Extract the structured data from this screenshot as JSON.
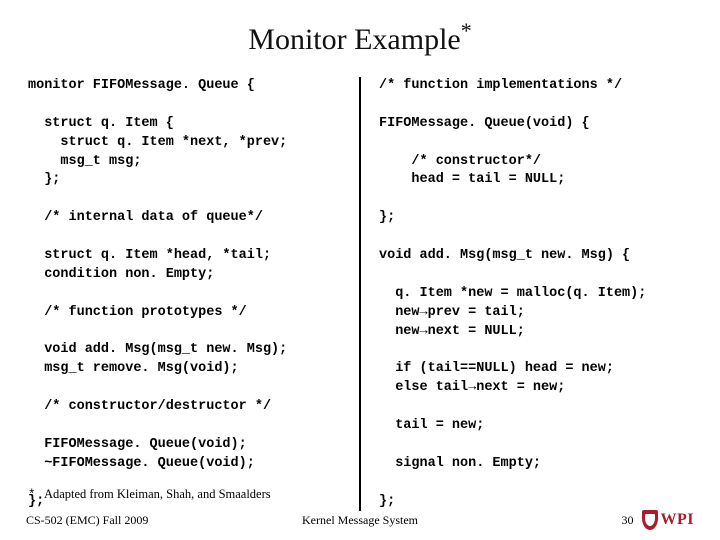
{
  "title": "Monitor Example",
  "title_suffix": "*",
  "code_left": "monitor FIFOMessage. Queue {\n\n  struct q. Item {\n    struct q. Item *next, *prev;\n    msg_t msg;\n  };\n\n  /* internal data of queue*/\n\n  struct q. Item *head, *tail;\n  condition non. Empty;\n\n  /* function prototypes */\n\n  void add. Msg(msg_t new. Msg);\n  msg_t remove. Msg(void);\n\n  /* constructor/destructor */\n\n  FIFOMessage. Queue(void);\n  ~FIFOMessage. Queue(void);\n\n};",
  "code_right": "/* function implementations */\n\nFIFOMessage. Queue(void) {\n\n    /* constructor*/\n    head = tail = NULL;\n\n};\n\nvoid add. Msg(msg_t new. Msg) {\n\n  q. Item *new = malloc(q. Item);\n  new→prev = tail;\n  new→next = NULL;\n\n  if (tail==NULL) head = new;\n  else tail→next = new;\n\n  tail = new;\n\n  signal non. Empty;\n\n};",
  "footnote_star": "*",
  "footnote_text": "Adapted from Kleiman, Shah, and Smaalders",
  "footer": {
    "left": "CS-502 (EMC) Fall 2009",
    "center": "Kernel Message System",
    "slide_number": "30",
    "logo_text": "WPI"
  }
}
